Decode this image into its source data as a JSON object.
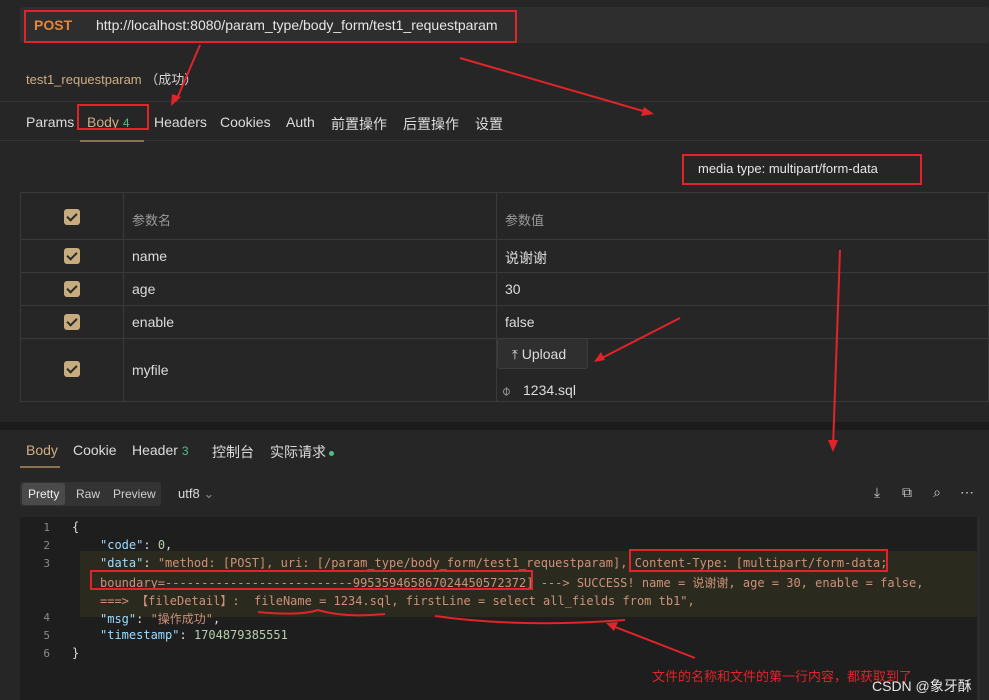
{
  "request": {
    "method": "POST",
    "url": "http://localhost:8080/param_type/body_form/test1_requestparam",
    "name": "test1_requestparam",
    "status": "（成功）"
  },
  "request_tabs": [
    {
      "label": "Params"
    },
    {
      "label": "Body",
      "count": "4"
    },
    {
      "label": "Headers"
    },
    {
      "label": "Cookies"
    },
    {
      "label": "Auth"
    },
    {
      "label": "前置操作"
    },
    {
      "label": "后置操作"
    },
    {
      "label": "设置"
    }
  ],
  "media_type": "media type: multipart/form-data",
  "params_table": {
    "headers": [
      "参数名",
      "参数值"
    ],
    "rows": [
      {
        "name": "name",
        "value": "说谢谢"
      },
      {
        "name": "age",
        "value": "30"
      },
      {
        "name": "enable",
        "value": "false"
      },
      {
        "name": "myfile",
        "upload_label": "Upload",
        "file": "1234.sql"
      }
    ]
  },
  "response_tabs": [
    {
      "label": "Body"
    },
    {
      "label": "Cookie"
    },
    {
      "label": "Header",
      "count": "3"
    },
    {
      "label": "控制台"
    },
    {
      "label": "实际请求"
    }
  ],
  "format_buttons": [
    "Pretty",
    "Raw",
    "Preview"
  ],
  "encoding": "utf8",
  "toolbar_icons": [
    "download-icon",
    "copy-icon",
    "search-icon",
    "more-icon"
  ],
  "code_lines": [
    {
      "num": "1",
      "text": "{"
    },
    {
      "num": "2",
      "key": "\"code\"",
      "rest": ": ",
      "val": "0",
      "tail": ","
    },
    {
      "num": "3",
      "key": "\"data\"",
      "rest": ": ",
      "val": "\"method: [POST], uri: [/param_type/body_form/test1_requestparam], Content-Type: [multipart/form-data;"
    },
    {
      "num": "",
      "text": "boundary=--------------------------995359465867024450572372] ---> SUCCESS! name = 说谢谢, age = 30, enable = false,"
    },
    {
      "num": "",
      "text": "===> 【fileDetail】:  fileName = 1234.sql, firstLine = select all_fields from tb1\","
    },
    {
      "num": "4",
      "key": "\"msg\"",
      "rest": ": ",
      "val": "\"操作成功\"",
      "tail": ","
    },
    {
      "num": "5",
      "key": "\"timestamp\"",
      "rest": ": ",
      "val": "1704879385551"
    },
    {
      "num": "6",
      "text": "}"
    }
  ],
  "annotation": "文件的名称和文件的第一行内容，都获取到了",
  "watermark": "CSDN @象牙酥",
  "colors": {
    "accent": "#cfae85",
    "method": "#e5863a",
    "annotation": "#e0242a",
    "count": "#4fbf8a"
  }
}
